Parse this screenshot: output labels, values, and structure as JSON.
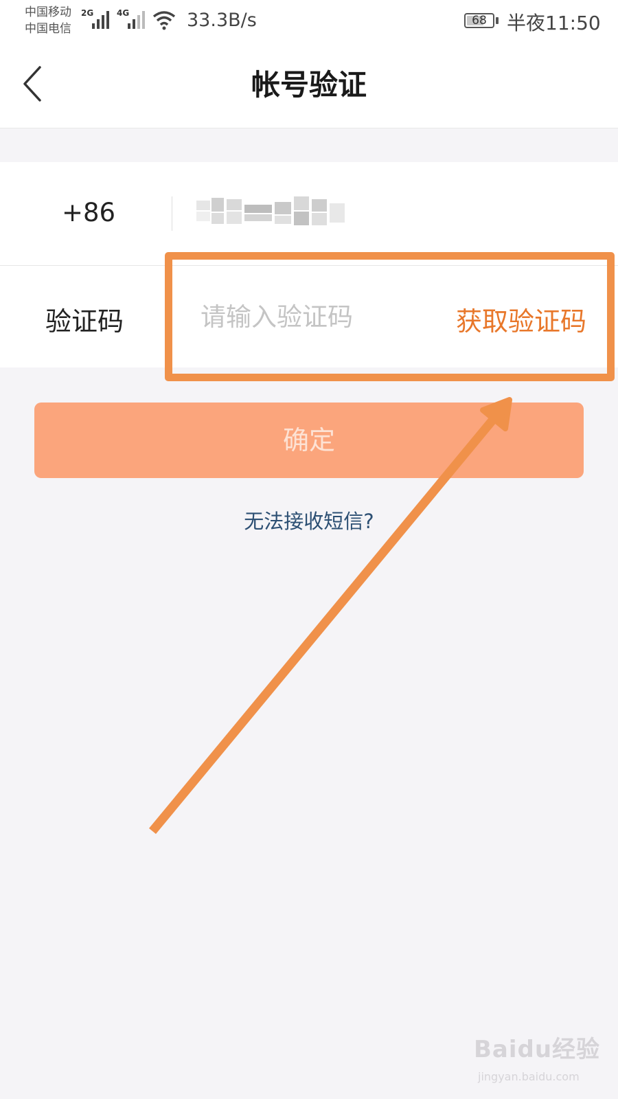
{
  "status_bar": {
    "carrier_1": "中国移动",
    "carrier_2": "中国电信",
    "network_1": "2G",
    "network_2": "4G",
    "speed": "33.3B/s",
    "battery": "68",
    "battery_level": 0.68,
    "time": "半夜11:50"
  },
  "header": {
    "title": "帐号验证"
  },
  "form": {
    "country_code": "+86",
    "code_label": "验证码",
    "code_placeholder": "请输入验证码",
    "code_value": "",
    "get_code_label": "获取验证码"
  },
  "confirm_label": "确定",
  "no_sms_link": "无法接收短信?",
  "watermark": {
    "main": "Baidu经验",
    "sub": "jingyan.baidu.com"
  },
  "colors": {
    "accent": "#e8772a",
    "button": "#fba57c",
    "highlight": "#f0914a",
    "link": "#2c4f73"
  }
}
